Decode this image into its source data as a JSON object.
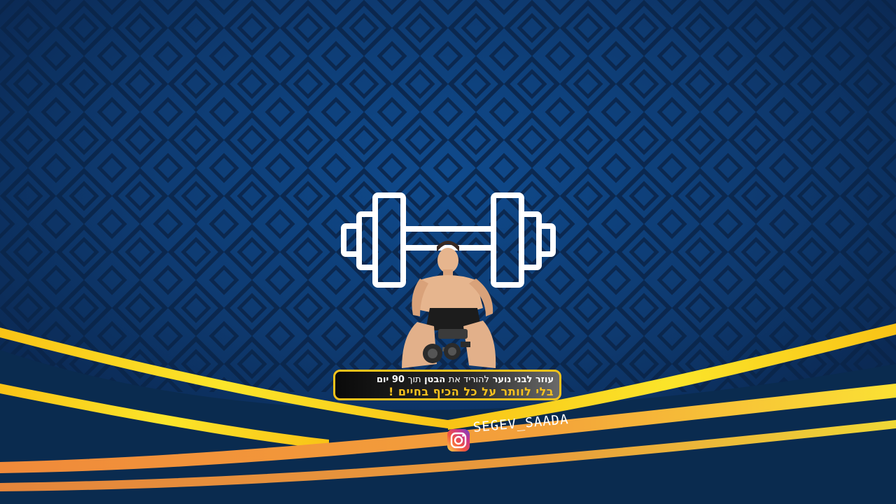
{
  "tagline": {
    "line1": {
      "part1": "עוזר לבני נוער",
      "part2": "להוריד את",
      "part3": "הבטן",
      "part4": "תוך",
      "part5": "90 יום"
    },
    "line2": "בלי לוותר על כל הכיף בחיים !"
  },
  "social": {
    "handle": "SEGEV_SAADA",
    "icon": "instagram-icon"
  },
  "colors": {
    "background": "#0e2e5c",
    "ribbon_yellow": "#f7c21f",
    "ribbon_orange": "#f19b3c",
    "frame_gold": "#f5c21b",
    "icon_white": "#ffffff"
  }
}
